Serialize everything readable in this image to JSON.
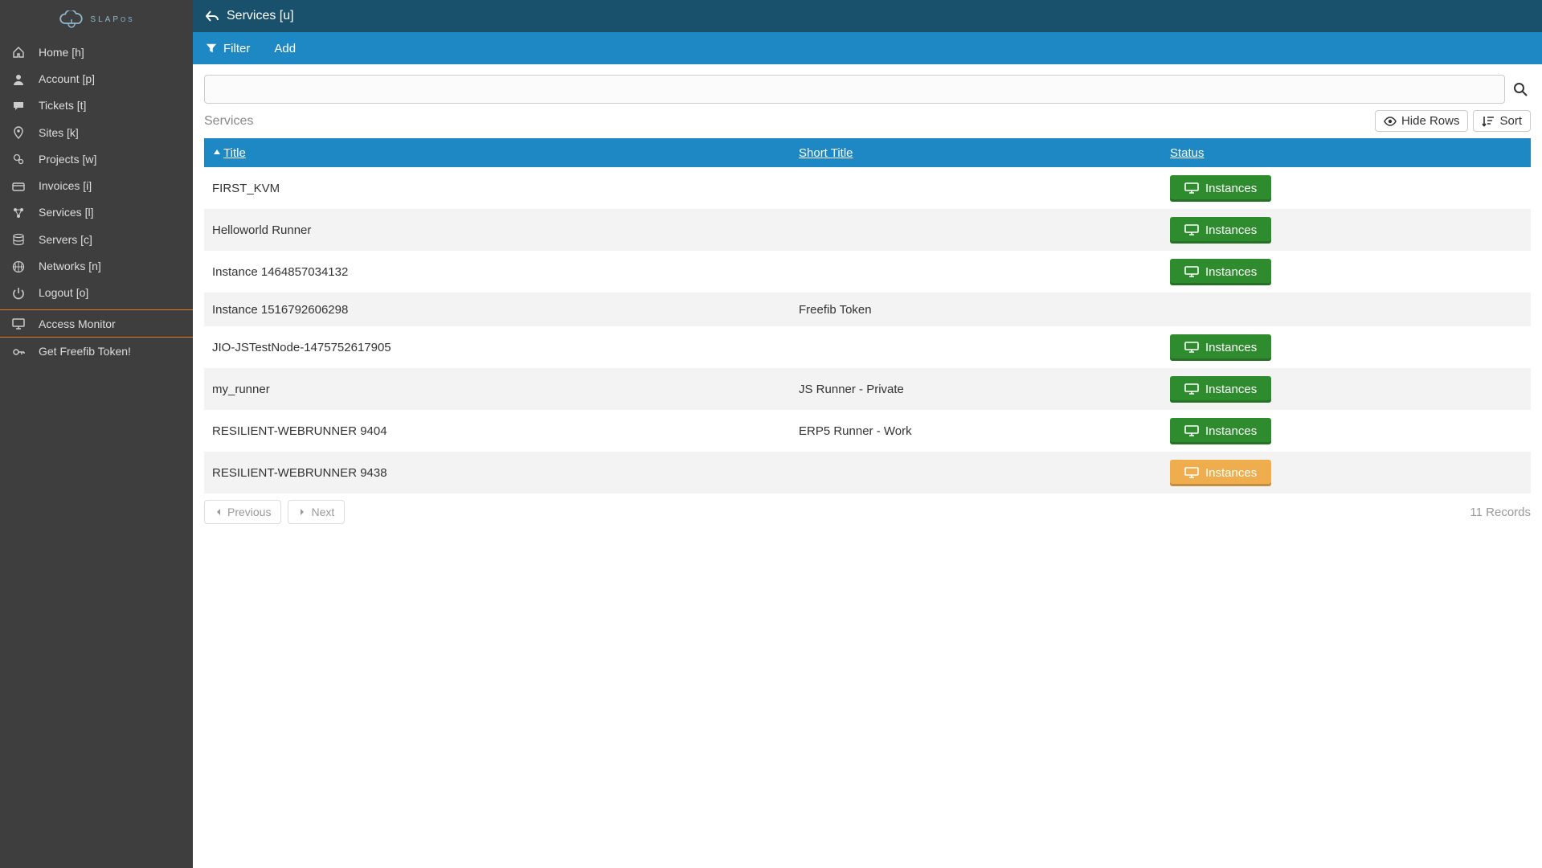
{
  "brand": {
    "name": "SLAP",
    "suffix": "OS"
  },
  "sidebar": {
    "items": [
      {
        "label": "Home [h]",
        "icon": "home-icon"
      },
      {
        "label": "Account [p]",
        "icon": "user-icon"
      },
      {
        "label": "Tickets [t]",
        "icon": "chat-icon"
      },
      {
        "label": "Sites [k]",
        "icon": "pin-icon"
      },
      {
        "label": "Projects [w]",
        "icon": "gears-icon"
      },
      {
        "label": "Invoices [i]",
        "icon": "card-icon"
      },
      {
        "label": "Services [l]",
        "icon": "molecule-icon"
      },
      {
        "label": "Servers [c]",
        "icon": "db-icon"
      },
      {
        "label": "Networks [n]",
        "icon": "globe-icon"
      },
      {
        "label": "Logout [o]",
        "icon": "power-icon"
      }
    ],
    "monitor_label": "Access Monitor",
    "token_label": "Get Freefib Token!"
  },
  "header": {
    "title": "Services [u]"
  },
  "toolbar": {
    "filter_label": "Filter",
    "add_label": "Add"
  },
  "search": {
    "value": ""
  },
  "meta": {
    "section_label": "Services",
    "hide_rows_label": "Hide Rows",
    "sort_label": "Sort"
  },
  "table": {
    "columns": {
      "title": "Title",
      "short": "Short Title",
      "status": "Status"
    },
    "button_label": "Instances",
    "rows": [
      {
        "title": "FIRST_KVM",
        "short": "",
        "status": "green"
      },
      {
        "title": "Helloworld Runner",
        "short": "",
        "status": "green"
      },
      {
        "title": "Instance 1464857034132",
        "short": "",
        "status": "green"
      },
      {
        "title": "Instance 1516792606298",
        "short": "Freefib Token",
        "status": "none"
      },
      {
        "title": "JIO-JSTestNode-1475752617905",
        "short": "",
        "status": "green"
      },
      {
        "title": "my_runner",
        "short": "JS Runner - Private",
        "status": "green"
      },
      {
        "title": "RESILIENT-WEBRUNNER 9404",
        "short": "ERP5 Runner - Work",
        "status": "green"
      },
      {
        "title": "RESILIENT-WEBRUNNER 9438",
        "short": "",
        "status": "orange"
      }
    ]
  },
  "pagination": {
    "prev": "Previous",
    "next": "Next",
    "records": "11 Records"
  }
}
